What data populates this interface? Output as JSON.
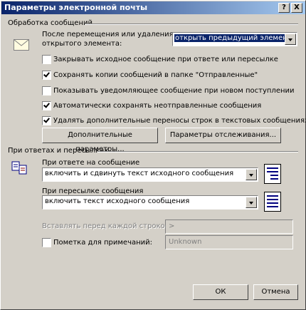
{
  "window": {
    "title": "Параметры электронной почты",
    "help_label": "?",
    "close_label": "X"
  },
  "message_handling": {
    "group_label": "Обработка сообщений",
    "after_move_label_line1": "После перемещения или удаления",
    "after_move_label_line2": "открытого элемента:",
    "after_move_value": "открыть предыдущий элемент",
    "options": [
      {
        "label": "Закрывать исходное сообщение при ответе или пересылке",
        "checked": false
      },
      {
        "label": "Сохранять копии сообщений в папке \"Отправленные\"",
        "checked": true
      },
      {
        "label": "Показывать уведомляющее сообщение при новом поступлении",
        "checked": false
      },
      {
        "label": "Автоматически сохранять неотправленные сообщения",
        "checked": true
      },
      {
        "label": "Удалять дополнительные переносы строк в текстовых сообщениях",
        "checked": true
      }
    ],
    "advanced_button": "Дополнительные параметры...",
    "tracking_button": "Параметры отслеживания..."
  },
  "replies": {
    "group_label": "При ответах и пересылках",
    "reply_label": "При ответе на сообщение",
    "reply_value": "включить и сдвинуть текст исходного сообщения",
    "forward_label": "При пересылке сообщения",
    "forward_value": "включить текст исходного сообщения",
    "prefix_label": "Вставлять перед каждой строкой:",
    "prefix_value": ">",
    "comments_label": "Пометка для примечаний:",
    "comments_checked": false,
    "comments_value": "Unknown"
  },
  "footer": {
    "ok_label": "ОК",
    "cancel_label": "Отмена"
  }
}
